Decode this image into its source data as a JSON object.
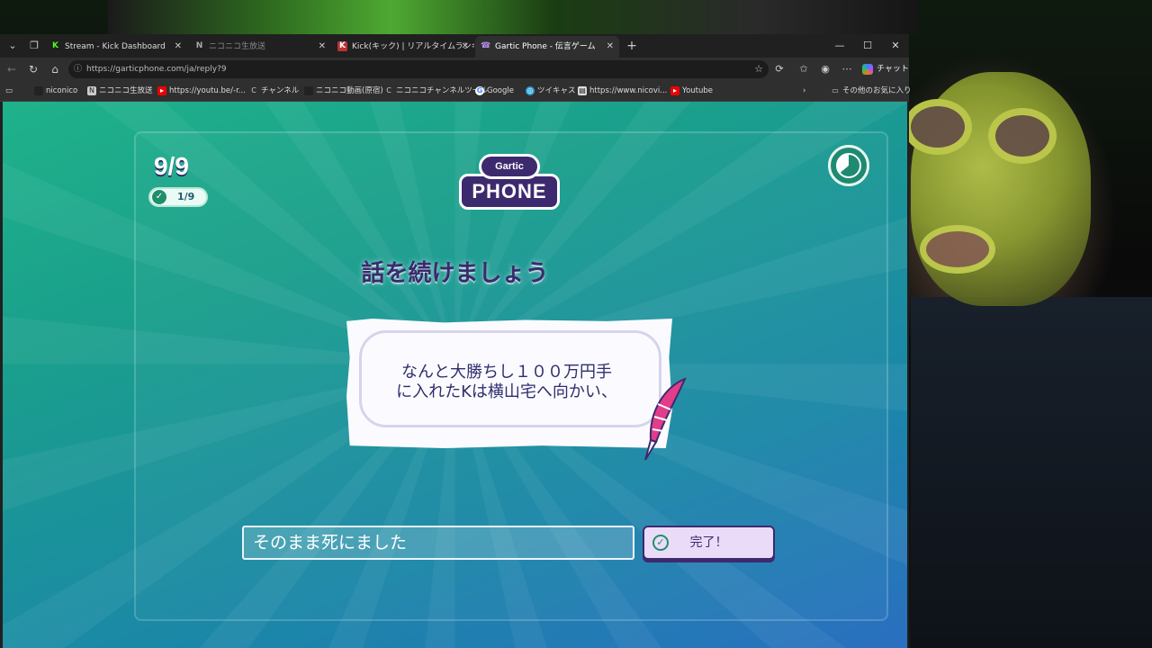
{
  "tabs": [
    {
      "label": "Stream - Kick Dashboard",
      "icon": "K"
    },
    {
      "label": "ニコニコ生放送",
      "icon": "N"
    },
    {
      "label": "Kick(キック) | リアルタイムランキング",
      "icon": "K"
    },
    {
      "label": "Gartic Phone - 伝言ゲーム",
      "icon": "☎"
    }
  ],
  "address": {
    "url": "https://garticphone.com/ja/reply?9"
  },
  "chat_label": "チャット",
  "bookmarks": [
    {
      "label": "niconico"
    },
    {
      "label": "ニコニコ生放送"
    },
    {
      "label": "https://youtu.be/-r..."
    },
    {
      "label": "チャンネル"
    },
    {
      "label": "ニコニコ動画(原宿)"
    },
    {
      "label": "ニコニコチャンネルツール"
    },
    {
      "label": "Google"
    },
    {
      "label": "ツイキャス"
    },
    {
      "label": "https://www.nicovi..."
    },
    {
      "label": "Youtube"
    }
  ],
  "other_bookmarks": "その他のお気に入り",
  "game": {
    "round": "9/9",
    "done_count": "1/9",
    "logo_top": "Gartic",
    "logo_bottom": "PHONE",
    "prompt_title": "話を続けましょう",
    "previous_line1": "なんと大勝ちし１００万円手",
    "previous_line2": "に入れたKは横山宅へ向かい、",
    "answer_value": "そのまま死にました",
    "done_button": "完了！"
  },
  "colors": {
    "accent": "#3d2a6e",
    "green": "#1f8f6a"
  }
}
